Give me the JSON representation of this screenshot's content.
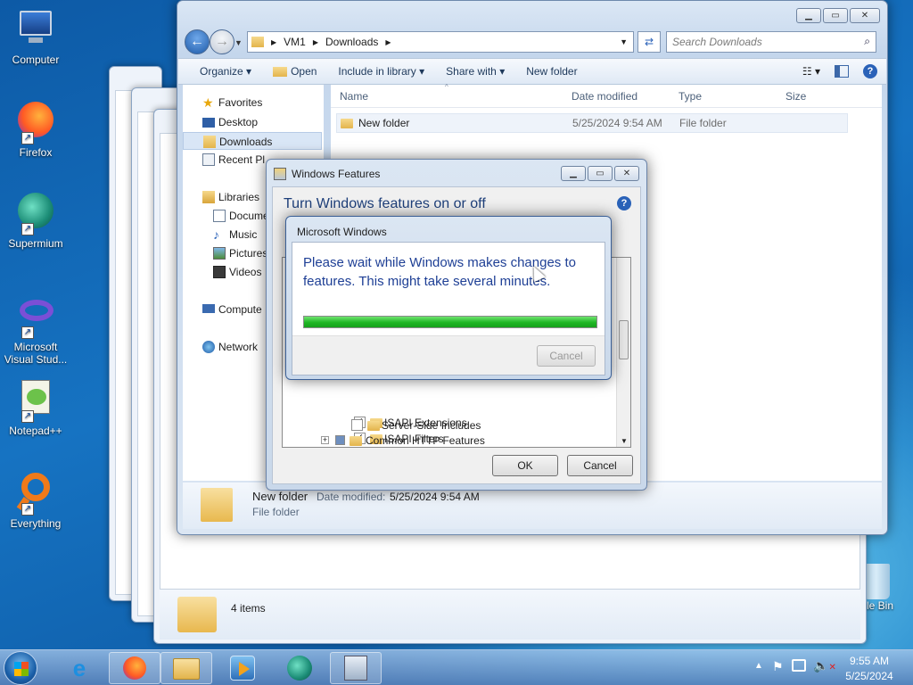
{
  "desktop": {
    "icons": [
      {
        "label": "Computer",
        "icon": "computer-icon"
      },
      {
        "label": "Firefox",
        "icon": "firefox-icon"
      },
      {
        "label": "Supermium",
        "icon": "supermium-icon"
      },
      {
        "label": "Microsoft Visual Stud...",
        "icon": "visual-studio-icon"
      },
      {
        "label": "Notepad++",
        "icon": "notepadpp-icon"
      },
      {
        "label": "Everything",
        "icon": "everything-icon"
      }
    ],
    "recycle_label": "cle Bin"
  },
  "explorer": {
    "breadcrumb": [
      "VM1",
      "Downloads"
    ],
    "search_placeholder": "Search Downloads",
    "toolbar": {
      "organize": "Organize",
      "open": "Open",
      "include": "Include in library",
      "share": "Share with",
      "new_folder": "New folder"
    },
    "nav": {
      "favorites": "Favorites",
      "desktop": "Desktop",
      "downloads": "Downloads",
      "recent": "Recent Pl",
      "libraries": "Libraries",
      "documents": "Docume",
      "music": "Music",
      "pictures": "Pictures",
      "videos": "Videos",
      "computer": "Compute",
      "network": "Network"
    },
    "columns": [
      "Name",
      "Date modified",
      "Type",
      "Size"
    ],
    "rows": [
      {
        "name": "New folder",
        "date": "5/25/2024 9:54 AM",
        "type": "File folder"
      }
    ],
    "details": {
      "name": "New folder",
      "date_label": "Date modified:",
      "date": "5/25/2024 9:54 AM",
      "type": "File folder"
    }
  },
  "back_window": {
    "status": "4 items"
  },
  "features": {
    "title": "Windows Features",
    "heading": "Turn Windows features on or off",
    "items": [
      {
        "label": "ISAPI Extensions",
        "checked": true
      },
      {
        "label": "ISAPI Filters",
        "checked": true
      },
      {
        "label": "Server-Side Includes",
        "checked": false
      },
      {
        "label": "Common HTTP Features",
        "checked": null
      }
    ],
    "ok": "OK",
    "cancel": "Cancel"
  },
  "progress": {
    "title": "Microsoft Windows",
    "message": "Please wait while Windows makes changes to features. This might take several minutes.",
    "percent": 100,
    "cancel": "Cancel"
  },
  "taskbar": {
    "time": "9:55 AM",
    "date": "5/25/2024"
  },
  "colors": {
    "accent": "#1e5aa8",
    "progress": "#22c22b"
  }
}
